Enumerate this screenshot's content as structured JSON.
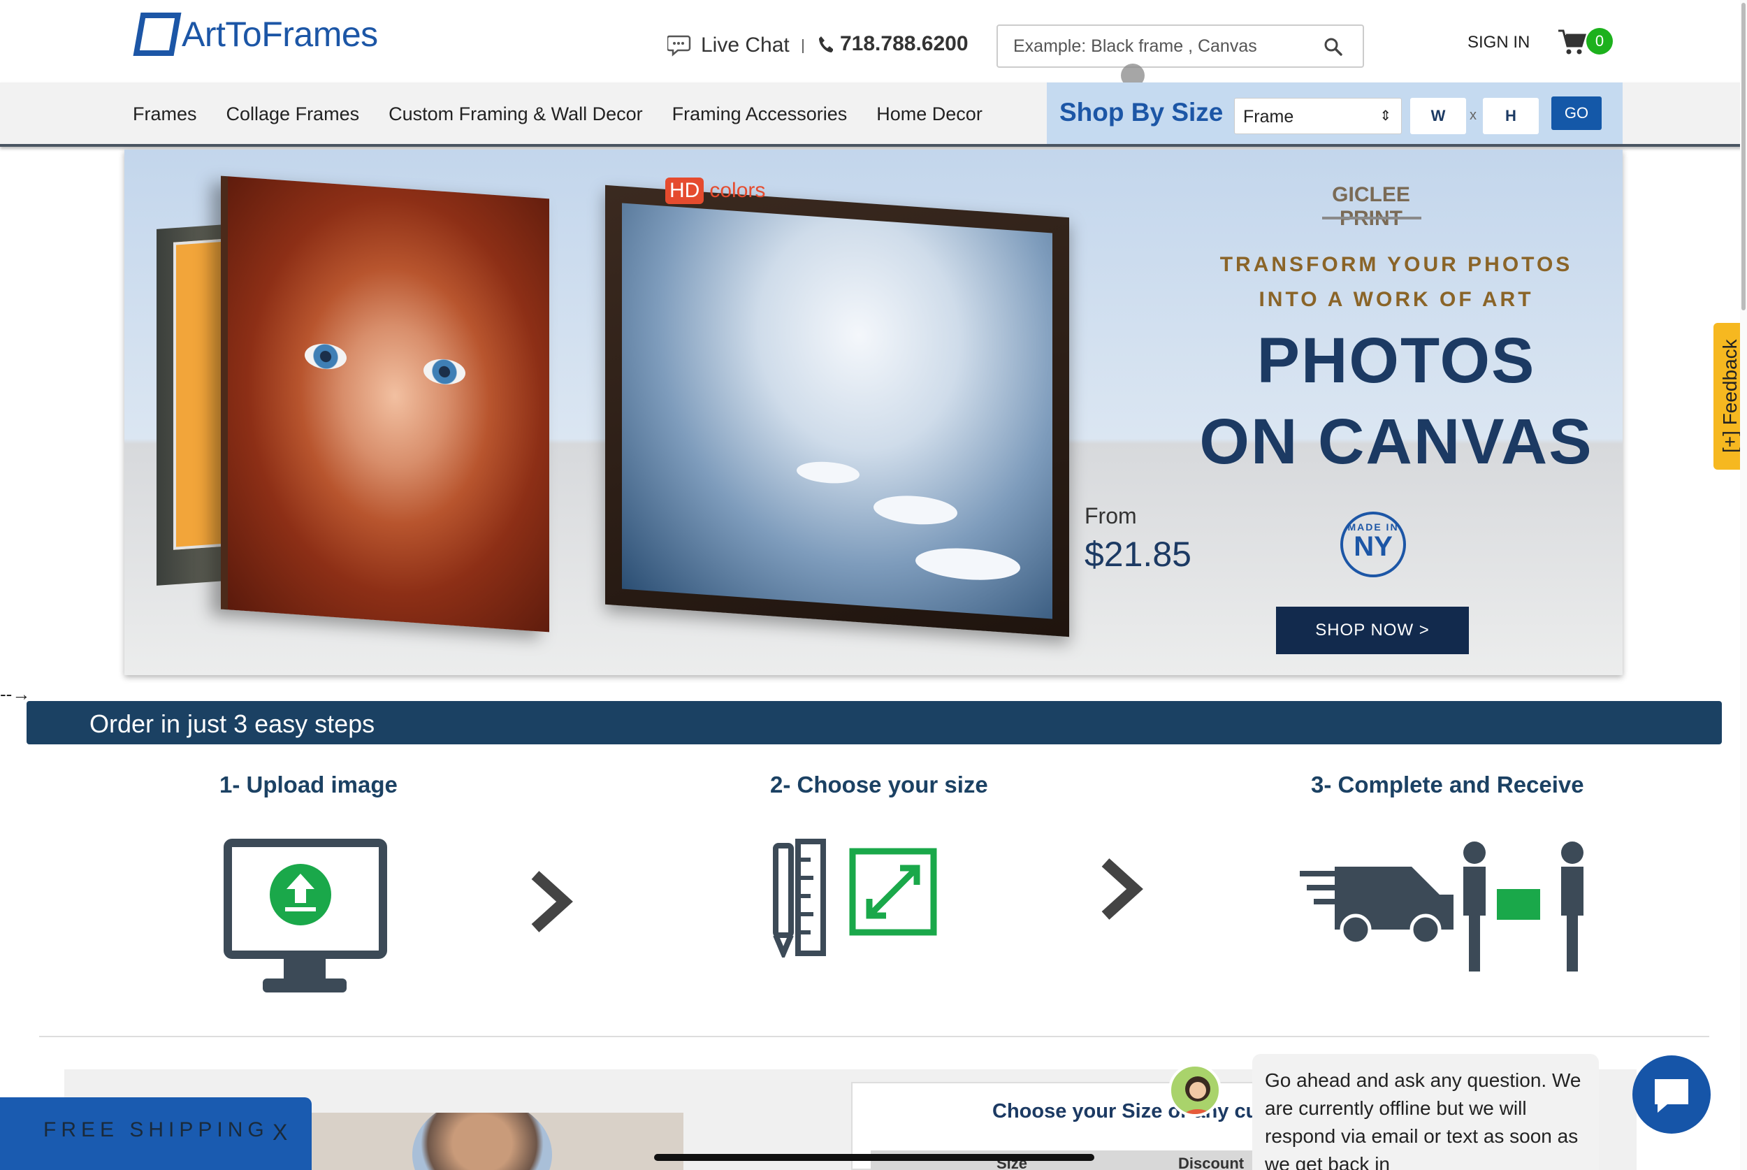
{
  "header": {
    "logo_text": "ArtToFrames",
    "live_chat": "Live Chat",
    "phone": "718.788.6200",
    "search_placeholder": "Example: Black frame , Canvas",
    "sign_in": "SIGN IN",
    "cart_count": "0"
  },
  "nav": {
    "items": [
      "Frames",
      "Collage Frames",
      "Custom Framing & Wall Decor",
      "Framing Accessories",
      "Home Decor"
    ],
    "shop_by_size": {
      "title": "Shop By Size",
      "select_value": "Frame",
      "width_label": "W",
      "x_label": "x",
      "height_label": "H",
      "go_label": "GO"
    }
  },
  "banner": {
    "hd": "HD",
    "colors": "colors",
    "giclee": "GICLEE PRINT",
    "tagline_1": "TRANSFORM YOUR PHOTOS",
    "tagline_2": "INTO A WORK OF ART",
    "headline_1": "PHOTOS",
    "headline_2": "ON CANVAS",
    "from_label": "From",
    "price": "$21.85",
    "made_in": "MADE IN",
    "ny": "NY",
    "cta": "SHOP NOW >"
  },
  "steps": {
    "bar_title": "Order in just 3 easy steps",
    "items": [
      {
        "title": "1- Upload image"
      },
      {
        "title": "2- Choose your size"
      },
      {
        "title": "3- Complete and Receive"
      }
    ]
  },
  "bottom": {
    "size_card_title": "Choose your Size or any cus",
    "size_col": "Size",
    "discount_col": "Discount",
    "free_shipping": "FREE SHIPPING",
    "free_shipping_close": "X",
    "chat_message": "Go ahead and ask any question. We are currently offline but we will respond via email or text as soon as we get back in",
    "feedback": "[+] Feedback"
  },
  "colors": {
    "brand_blue": "#1c56a6",
    "navy": "#1b4163",
    "accent_gold": "#8a6428",
    "cart_badge_green": "#1db11d",
    "feedback_yellow": "#f6b820"
  }
}
